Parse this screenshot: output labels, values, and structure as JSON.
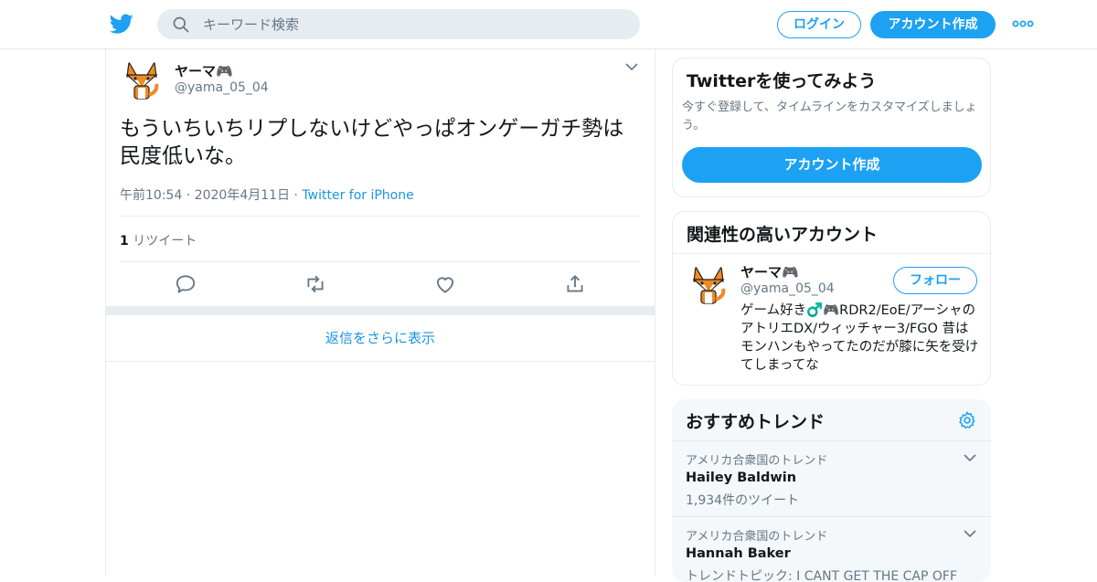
{
  "header": {
    "search_placeholder": "キーワード検索",
    "login_label": "ログイン",
    "signup_label": "アカウント作成"
  },
  "tweet": {
    "author_name": "ヤーマ🎮",
    "author_handle": "@yama_05_04",
    "text": "もういちいちリプしないけどやっぱオンゲーガチ勢は民度低いな。",
    "time": "午前10:54 · 2020年4月11日 · ",
    "source": "Twitter for iPhone",
    "retweet_count": "1",
    "retweet_label": " リツイート",
    "show_more_replies": "返信をさらに表示"
  },
  "sidebar": {
    "signup_card": {
      "title": "Twitterを使ってみよう",
      "subtitle": "今すぐ登録して、タイムラインをカスタマイズしましょう。",
      "button": "アカウント作成"
    },
    "related": {
      "title": "関連性の高いアカウント",
      "name": "ヤーマ🎮",
      "handle": "@yama_05_04",
      "follow_label": "フォロー",
      "bio": "ゲーム好き♂️🎮RDR2/EoE/アーシャのアトリエDX/ウィッチャー3/FGO 昔はモンハンもやってたのだが膝に矢を受けてしまってな"
    },
    "trends": {
      "title": "おすすめトレンド",
      "items": [
        {
          "location": "アメリカ合衆国のトレンド",
          "name": "Hailey Baldwin",
          "count": "1,934件のツイート"
        },
        {
          "location": "アメリカ合衆国のトレンド",
          "name": "Hannah Baker",
          "count": "トレンドトピック: I CANT GET THE CAP OFF"
        }
      ]
    }
  },
  "colors": {
    "brand": "#1da1f2",
    "link": "#1b95e0",
    "muted": "#657786",
    "text": "#14171a"
  }
}
